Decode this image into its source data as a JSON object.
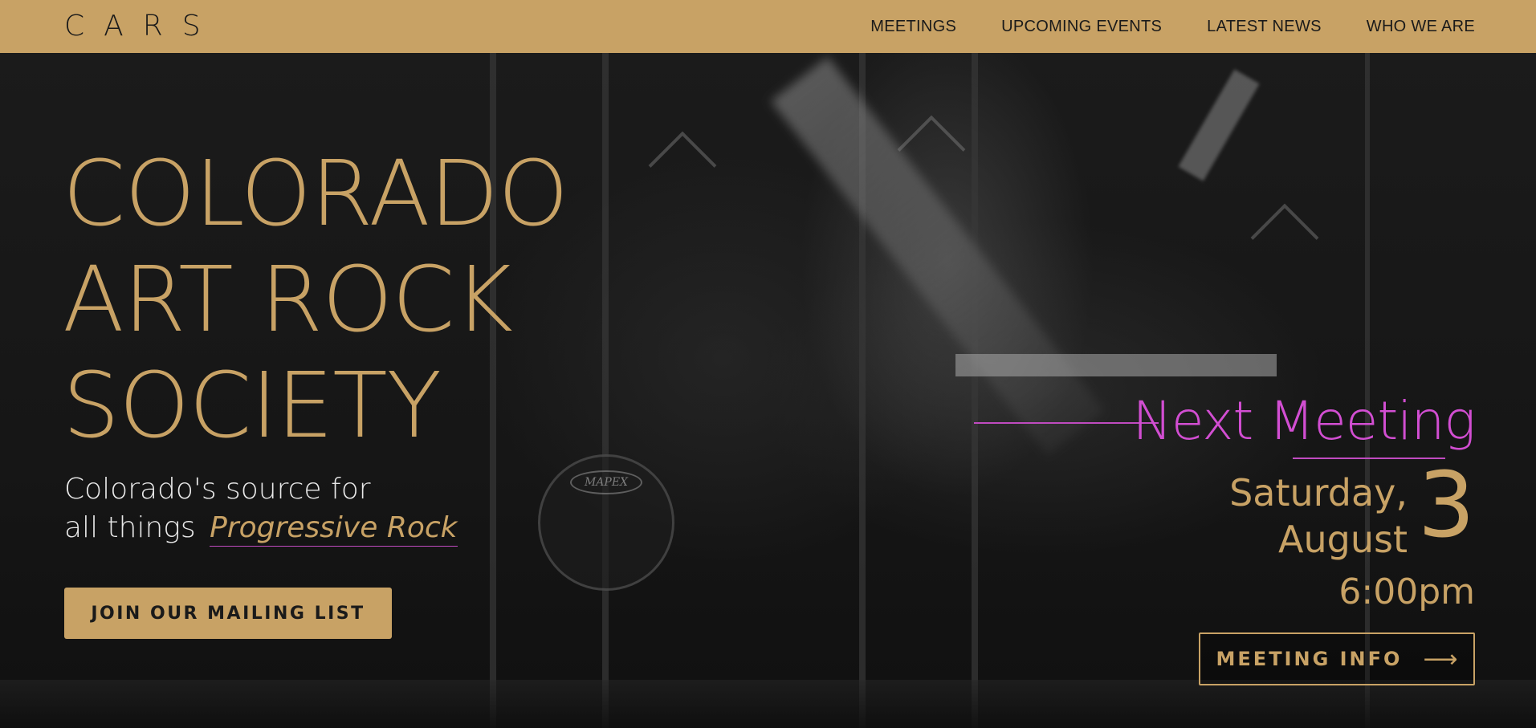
{
  "header": {
    "logo": "CARS",
    "nav": [
      "MEETINGS",
      "UPCOMING EVENTS",
      "LATEST NEWS",
      "WHO WE ARE"
    ]
  },
  "hero": {
    "title_lines": [
      "COLORADO",
      "ART ROCK",
      "SOCIETY"
    ],
    "tagline_line1": "Colorado's source for",
    "tagline_line2_prefix": "all things",
    "tagline_accent": "Progressive Rock",
    "join_button": "JOIN OUR MAILING LIST",
    "background_image_label": "MAPEX"
  },
  "next_meeting": {
    "heading": "Next Meeting",
    "weekday": "Saturday,",
    "month": "August",
    "day": "3",
    "time": "6:00pm",
    "info_button": "MEETING INFO",
    "info_button_icon": "arrow-right-icon"
  },
  "colors": {
    "gold": "#c8a265",
    "magenta": "#d24ed2",
    "background": "#121212"
  }
}
